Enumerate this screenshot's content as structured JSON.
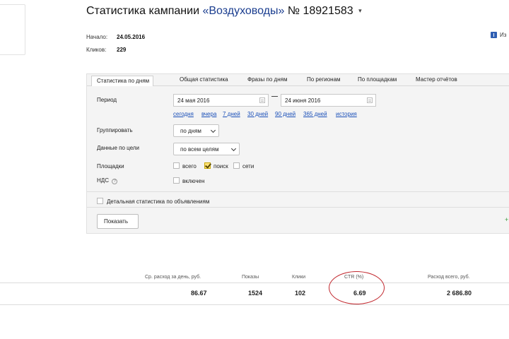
{
  "header": {
    "title_prefix": "Статистика кампании",
    "campaign_name": "«Воздуховоды»",
    "campaign_number": "№ 18921583",
    "caret": "▾"
  },
  "meta": {
    "start_label": "Начало:",
    "start_value": "24.05.2016",
    "clicks_label": "Кликов:",
    "clicks_value": "229"
  },
  "right_panel": {
    "text": "Из"
  },
  "tabs": [
    {
      "label": "Статистика по дням",
      "active": true
    },
    {
      "label": "Общая статистика",
      "active": false
    },
    {
      "label": "Фразы по дням",
      "active": false
    },
    {
      "label": "По регионам",
      "active": false
    },
    {
      "label": "По площадкам",
      "active": false
    },
    {
      "label": "Мастер отчётов",
      "active": false
    }
  ],
  "form": {
    "period_label": "Период",
    "date_from": "24 мая 2016",
    "date_to": "24 июня 2016",
    "quick_links": [
      "сегодня",
      "вчера",
      "7 дней",
      "30 дней",
      "90 дней",
      "365 дней",
      "история"
    ],
    "group_label": "Группировать",
    "group_value": "по дням",
    "goals_label": "Данные по цели",
    "goals_value": "по всем целям",
    "platforms_label": "Площадки",
    "platform_all": "всего",
    "platform_search": "поиск",
    "platform_network": "сети",
    "vat_label": "НДС",
    "vat_help": "?",
    "vat_option": "включен",
    "detailed_label": "Детальная статистика по объявлениям",
    "show_button": "Показать"
  },
  "summary": {
    "headers": {
      "avg_daily": "Ср. расход за день, руб.",
      "impressions": "Показы",
      "clicks": "Клики",
      "ctr": "CTR (%)",
      "total": "Расход всего, руб."
    },
    "values": {
      "avg_daily": "86.67",
      "impressions": "1524",
      "clicks": "102",
      "ctr": "6.69",
      "total": "2 686.80"
    }
  },
  "colors": {
    "link": "#1a4fb8",
    "highlight_ring": "#c1272d",
    "checkbox_checked": "#ffe27a"
  }
}
